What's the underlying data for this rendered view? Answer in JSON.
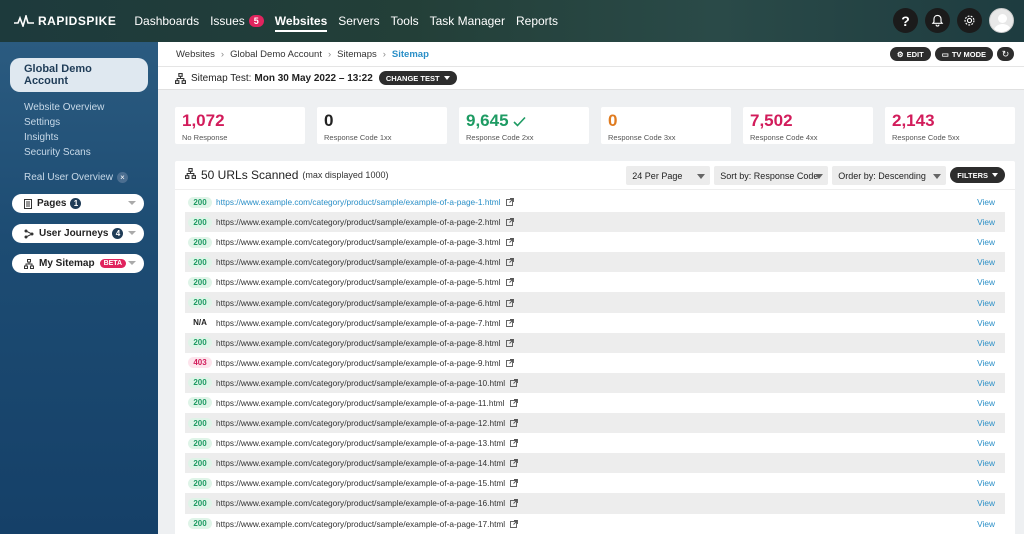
{
  "brand": {
    "name": "RAPIDSPIKE"
  },
  "nav": {
    "items": [
      {
        "label": "Dashboards"
      },
      {
        "label": "Issues",
        "badge": "5"
      },
      {
        "label": "Websites",
        "active": true
      },
      {
        "label": "Servers"
      },
      {
        "label": "Tools"
      },
      {
        "label": "Task Manager"
      },
      {
        "label": "Reports"
      }
    ],
    "help_label": "?"
  },
  "sidebar": {
    "account": "Global Demo Account",
    "links": [
      "Website Overview",
      "Settings",
      "Insights",
      "Security Scans"
    ],
    "rum": "Real User Overview",
    "pages": {
      "label": "Pages",
      "count": "1"
    },
    "journeys": {
      "label": "User Journeys",
      "count": "4"
    },
    "sitemap": {
      "label": "My Sitemap",
      "beta": "BETA"
    }
  },
  "breadcrumb": {
    "items": [
      "Websites",
      "Global Demo Account",
      "Sitemaps"
    ],
    "current": "Sitemap"
  },
  "actions": {
    "edit": "EDIT",
    "tv": "TV MODE"
  },
  "test": {
    "label": "Sitemap Test:",
    "date": "Mon 30 May 2022 – 13:22",
    "change": "CHANGE TEST"
  },
  "stats": [
    {
      "value": "1,072",
      "label": "No Response",
      "color": "#d21c5b"
    },
    {
      "value": "0",
      "label": "Response Code 1xx",
      "color": "#222222"
    },
    {
      "value": "9,645",
      "label": "Response Code 2xx",
      "color": "#1e9b63",
      "check": true
    },
    {
      "value": "0",
      "label": "Response Code 3xx",
      "color": "#e07b1f"
    },
    {
      "value": "7,502",
      "label": "Response Code 4xx",
      "color": "#d21c5b"
    },
    {
      "value": "2,143",
      "label": "Response Code 5xx",
      "color": "#d21c5b"
    }
  ],
  "panel": {
    "title": "50 URLs Scanned",
    "subtitle": "(max displayed 1000)",
    "per_page": "24 Per Page",
    "sort": "Sort by: Response Code",
    "order": "Order by: Descending",
    "filters": "FILTERS",
    "view_label": "View"
  },
  "rows": [
    {
      "code": "200",
      "url": "https://www.example.com/category/product/sample/example-of-a-page-1.html"
    },
    {
      "code": "200",
      "url": "https://www.example.com/category/product/sample/example-of-a-page-2.html"
    },
    {
      "code": "200",
      "url": "https://www.example.com/category/product/sample/example-of-a-page-3.html"
    },
    {
      "code": "200",
      "url": "https://www.example.com/category/product/sample/example-of-a-page-4.html"
    },
    {
      "code": "200",
      "url": "https://www.example.com/category/product/sample/example-of-a-page-5.html"
    },
    {
      "code": "200",
      "url": "https://www.example.com/category/product/sample/example-of-a-page-6.html"
    },
    {
      "code": "N/A",
      "url": "https://www.example.com/category/product/sample/example-of-a-page-7.html"
    },
    {
      "code": "200",
      "url": "https://www.example.com/category/product/sample/example-of-a-page-8.html"
    },
    {
      "code": "403",
      "url": "https://www.example.com/category/product/sample/example-of-a-page-9.html"
    },
    {
      "code": "200",
      "url": "https://www.example.com/category/product/sample/example-of-a-page-10.html"
    },
    {
      "code": "200",
      "url": "https://www.example.com/category/product/sample/example-of-a-page-11.html"
    },
    {
      "code": "200",
      "url": "https://www.example.com/category/product/sample/example-of-a-page-12.html"
    },
    {
      "code": "200",
      "url": "https://www.example.com/category/product/sample/example-of-a-page-13.html"
    },
    {
      "code": "200",
      "url": "https://www.example.com/category/product/sample/example-of-a-page-14.html"
    },
    {
      "code": "200",
      "url": "https://www.example.com/category/product/sample/example-of-a-page-15.html"
    },
    {
      "code": "200",
      "url": "https://www.example.com/category/product/sample/example-of-a-page-16.html"
    },
    {
      "code": "200",
      "url": "https://www.example.com/category/product/sample/example-of-a-page-17.html"
    }
  ]
}
